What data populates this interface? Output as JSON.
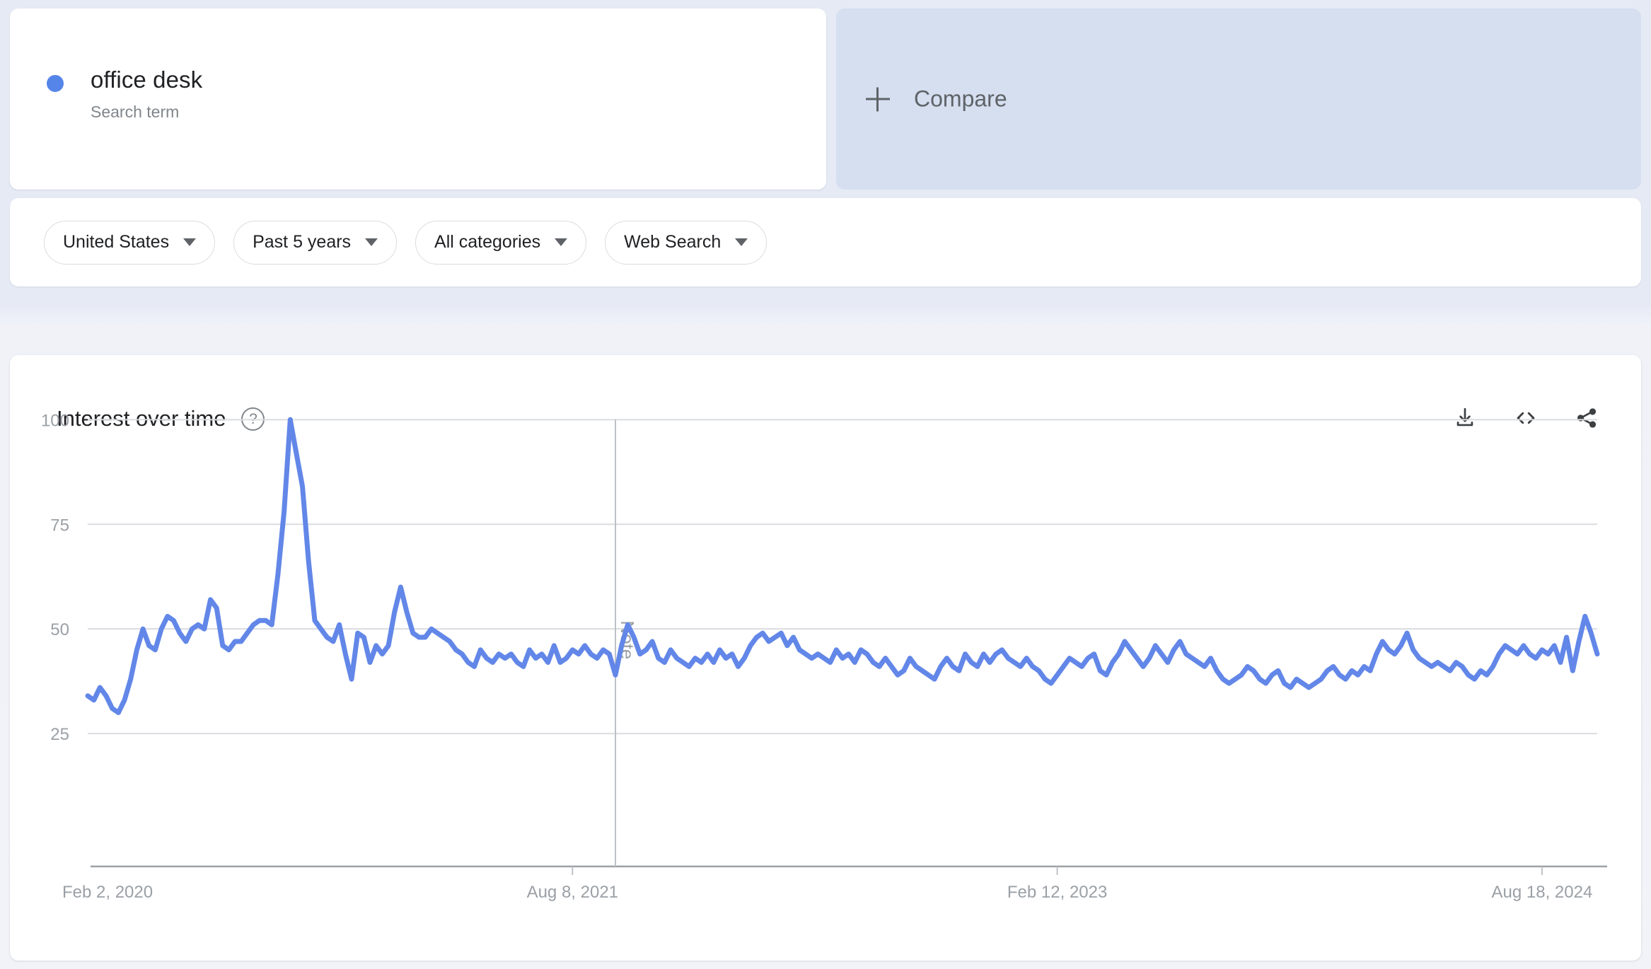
{
  "search_term": {
    "title": "office desk",
    "subtitle": "Search term",
    "dot_color": "#5585e8"
  },
  "compare": {
    "label": "Compare",
    "plus_icon": "plus-icon",
    "background": "#d6dff0"
  },
  "filters": [
    {
      "label": "United States",
      "name": "location"
    },
    {
      "label": "Past 5 years",
      "name": "time-range"
    },
    {
      "label": "All categories",
      "name": "category"
    },
    {
      "label": "Web Search",
      "name": "search-type"
    }
  ],
  "chart_panel": {
    "title": "Interest over time",
    "help_icon": "?",
    "actions": [
      {
        "name": "download-icon",
        "label": "Download CSV"
      },
      {
        "name": "embed-icon",
        "label": "Embed"
      },
      {
        "name": "share-icon",
        "label": "Share"
      }
    ]
  },
  "chart_data": {
    "type": "line",
    "title": "Interest over time",
    "xlabel": "",
    "ylabel": "",
    "ylim": [
      0,
      108
    ],
    "yticks": [
      25,
      50,
      75,
      100
    ],
    "grid": true,
    "legend": "none",
    "line_color": "#6287e8",
    "xtick_labels": [
      "Feb 2, 2020",
      "Aug 8, 2021",
      "Feb 12, 2023",
      "Aug 18, 2024"
    ],
    "xtick_positions": [
      0,
      79,
      158,
      237
    ],
    "annotations": [
      {
        "label": "Note",
        "x_index": 86,
        "orientation": "vertical"
      }
    ],
    "series": [
      {
        "name": "office desk",
        "values": [
          34,
          33,
          36,
          34,
          31,
          30,
          33,
          38,
          45,
          50,
          46,
          45,
          50,
          53,
          52,
          49,
          47,
          50,
          51,
          50,
          57,
          55,
          46,
          45,
          47,
          47,
          49,
          51,
          52,
          52,
          51,
          63,
          78,
          100,
          92,
          84,
          66,
          52,
          50,
          48,
          47,
          51,
          44,
          38,
          49,
          48,
          42,
          46,
          44,
          46,
          54,
          60,
          54,
          49,
          48,
          48,
          50,
          49,
          48,
          47,
          45,
          44,
          42,
          41,
          45,
          43,
          42,
          44,
          43,
          44,
          42,
          41,
          45,
          43,
          44,
          42,
          46,
          42,
          43,
          45,
          44,
          46,
          44,
          43,
          45,
          44,
          39,
          46,
          51,
          48,
          44,
          45,
          47,
          43,
          42,
          45,
          43,
          42,
          41,
          43,
          42,
          44,
          42,
          45,
          43,
          44,
          41,
          43,
          46,
          48,
          49,
          47,
          48,
          49,
          46,
          48,
          45,
          44,
          43,
          44,
          43,
          42,
          45,
          43,
          44,
          42,
          45,
          44,
          42,
          41,
          43,
          41,
          39,
          40,
          43,
          41,
          40,
          39,
          38,
          41,
          43,
          41,
          40,
          44,
          42,
          41,
          44,
          42,
          44,
          45,
          43,
          42,
          41,
          43,
          41,
          40,
          38,
          37,
          39,
          41,
          43,
          42,
          41,
          43,
          44,
          40,
          39,
          42,
          44,
          47,
          45,
          43,
          41,
          43,
          46,
          44,
          42,
          45,
          47,
          44,
          43,
          42,
          41,
          43,
          40,
          38,
          37,
          38,
          39,
          41,
          40,
          38,
          37,
          39,
          40,
          37,
          36,
          38,
          37,
          36,
          37,
          38,
          40,
          41,
          39,
          38,
          40,
          39,
          41,
          40,
          44,
          47,
          45,
          44,
          46,
          49,
          45,
          43,
          42,
          41,
          42,
          41,
          40,
          42,
          41,
          39,
          38,
          40,
          39,
          41,
          44,
          46,
          45,
          44,
          46,
          44,
          43,
          45,
          44,
          46,
          42,
          48,
          40,
          47,
          53,
          49,
          44
        ]
      }
    ]
  }
}
